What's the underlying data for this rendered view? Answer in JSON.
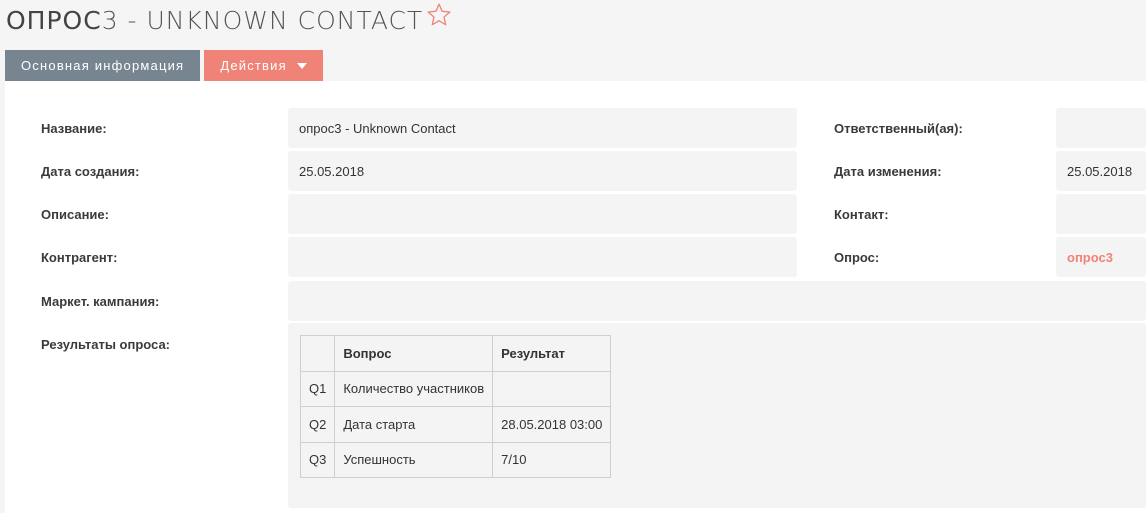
{
  "header": {
    "title_first": "ОПРОС",
    "title_rest": "3 - UNKNOWN CONTACT"
  },
  "tabs": {
    "main_label": "Основная информация",
    "actions_label": "Действия"
  },
  "fields": {
    "name_label": "Название:",
    "name_value": "опрос3 - Unknown Contact",
    "created_label": "Дата создания:",
    "created_value": "25.05.2018",
    "description_label": "Описание:",
    "description_value": "",
    "account_label": "Контрагент:",
    "account_value": "",
    "campaign_label": "Маркет. кампания:",
    "campaign_value": "",
    "results_label": "Результаты опроса:",
    "assigned_label": "Ответственный(ая):",
    "assigned_value": "",
    "modified_label": "Дата изменения:",
    "modified_value": "25.05.2018",
    "contact_label": "Контакт:",
    "contact_value": "",
    "survey_label": "Опрос:",
    "survey_value": "опрос3"
  },
  "results": {
    "headers": [
      "",
      "Вопрос",
      "Результат"
    ],
    "rows": [
      {
        "num": "Q1",
        "question": "Количество участников",
        "result": ""
      },
      {
        "num": "Q2",
        "question": "Дата старта",
        "result": "28.05.2018 03:00"
      },
      {
        "num": "Q3",
        "question": "Успешность",
        "result": "7/10"
      }
    ]
  },
  "colors": {
    "accent": "#f08377",
    "tab_main": "#778591",
    "field_bg": "#f4f4f4"
  },
  "icons": {
    "favorite": "star-outline-icon",
    "dropdown": "caret-down-icon"
  }
}
